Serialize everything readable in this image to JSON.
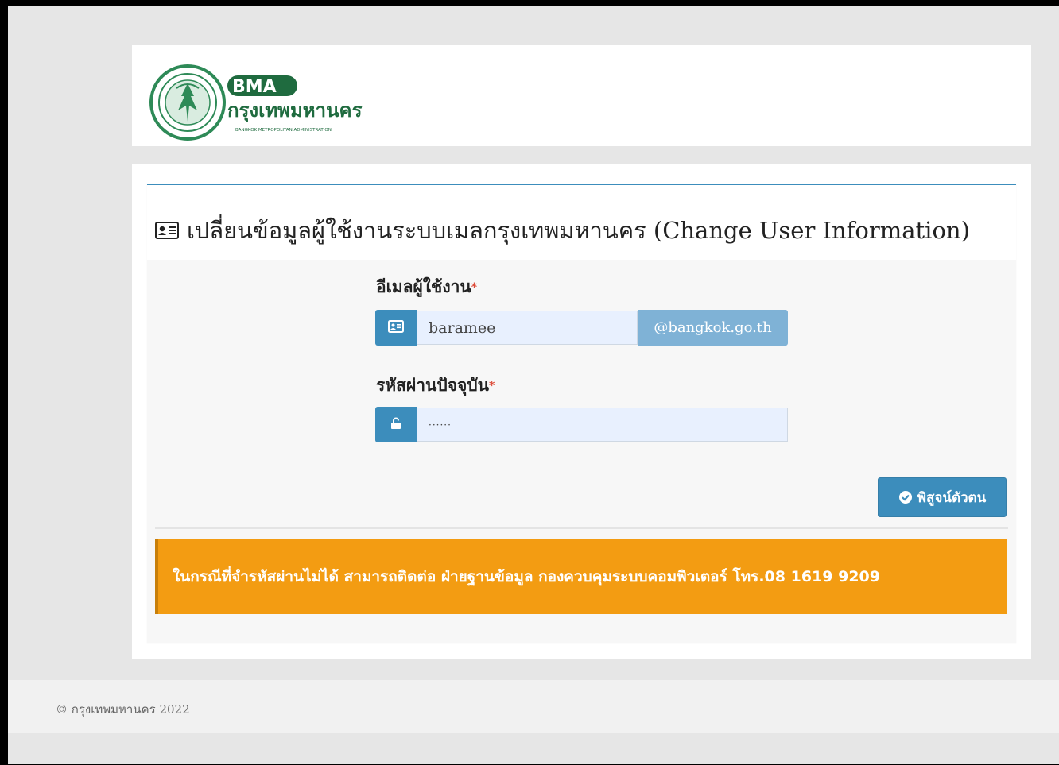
{
  "logo": {
    "abbr": "BMA",
    "thai_name": "กรุงเทพมหานคร",
    "english_name": "BANGKOK METROPOLITAN ADMINISTRATION",
    "brand_color": "#2e8a57"
  },
  "page": {
    "title": "เปลี่ยนข้อมูลผู้ใช้งานระบบเมลกรุงเทพมหานคร (Change User Information)",
    "title_icon": "id-card-icon"
  },
  "form": {
    "username_label": "อีเมลผู้ใช้งาน",
    "required_mark": "*",
    "username_value": "baramee",
    "email_domain": "@bangkok.go.th",
    "username_icon": "id-card-icon",
    "password_label": "รหัสผ่านปัจจุบัน",
    "password_value": "······",
    "password_icon": "unlock-icon"
  },
  "actions": {
    "verify_label": "พิสูจน์ตัวตน",
    "verify_icon": "check-circle-icon"
  },
  "alert": {
    "text": "ในกรณีที่จำรหัสผ่านไม่ได้ สามารถติดต่อ ฝ่ายฐานข้อมูล กองควบคุมระบบคอมพิวเตอร์ โทร.08 1619 9209",
    "color": "#f39c12"
  },
  "footer": {
    "copyright": "© กรุงเทพมหานคร 2022"
  },
  "colors": {
    "primary": "#3c8dbc",
    "input_bg": "#e8f0fe"
  }
}
